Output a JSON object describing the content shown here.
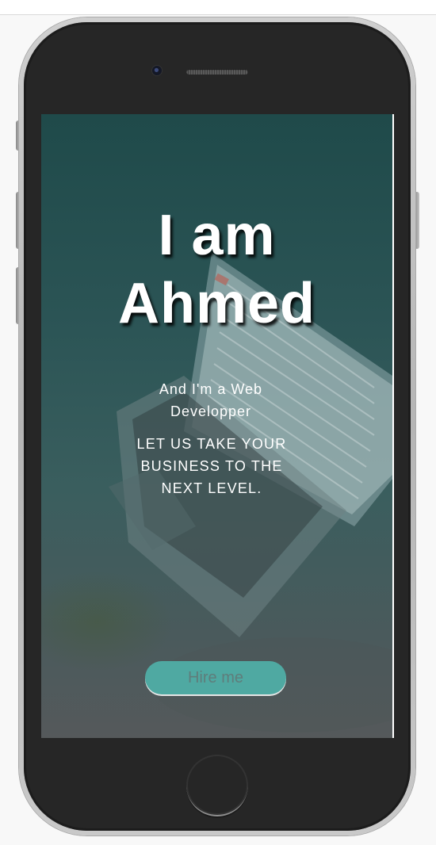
{
  "hero": {
    "line1": "I am",
    "line2": "Ahmed"
  },
  "subtitle": "And I'm a Web Developper",
  "tagline": "LET US TAKE YOUR BUSINESS TO THE NEXT LEVEL.",
  "hire_button": {
    "label": "Hire me"
  },
  "colors": {
    "accent": "#4fa9a2",
    "overlay": "#2c5556",
    "phone_body": "#262626",
    "text": "#ffffff"
  },
  "icons": {
    "camera": "camera-icon",
    "speaker": "speaker-grille",
    "home": "home-button"
  }
}
